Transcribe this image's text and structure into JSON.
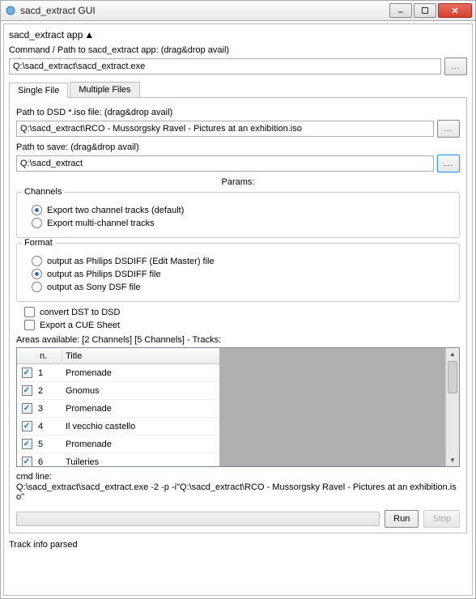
{
  "window": {
    "title": "sacd_extract GUI"
  },
  "header": {
    "appLabel": "sacd_extract app"
  },
  "command": {
    "label": "Command / Path to sacd_extract app: (drag&drop avail)",
    "value": "Q:\\sacd_extract\\sacd_extract.exe",
    "browse": "..."
  },
  "tabs": {
    "single": "Single File",
    "multiple": "Multiple Files"
  },
  "single": {
    "isoLabel": "Path to DSD *.iso file: (drag&drop avail)",
    "isoValue": "Q:\\sacd_extract\\RCO - Mussorgsky Ravel - Pictures at an exhibition.iso",
    "saveLabel": "Path to save: (drag&drop avail)",
    "saveValue": "Q:\\sacd_extract",
    "browse": "..."
  },
  "params": {
    "title": "Params:",
    "channelsLabel": "Channels",
    "channels": {
      "two": "Export two channel tracks (default)",
      "multi": "Export multi-channel tracks"
    },
    "formatLabel": "Format",
    "format": {
      "dsdiff_edit": "output as Philips DSDIFF (Edit Master) file",
      "dsdiff": "output as Philips DSDIFF file",
      "dsf": "output as Sony DSF file"
    },
    "convertDST": "convert DST to DSD",
    "exportCUE": "Export a CUE Sheet"
  },
  "areas": {
    "label": "Areas available: [2 Channels] [5 Channels] - Tracks:",
    "cols": {
      "n": "n.",
      "title": "Title"
    },
    "tracks": [
      {
        "n": "1",
        "title": "Promenade"
      },
      {
        "n": "2",
        "title": "Gnomus"
      },
      {
        "n": "3",
        "title": "Promenade"
      },
      {
        "n": "4",
        "title": "Il vecchio castello"
      },
      {
        "n": "5",
        "title": "Promenade"
      },
      {
        "n": "6",
        "title": "Tuileries"
      }
    ]
  },
  "cmdline": {
    "label": "cmd line:",
    "value": "Q:\\sacd_extract\\sacd_extract.exe -2 -p  -i\"Q:\\sacd_extract\\RCO - Mussorgsky Ravel - Pictures at an exhibition.iso\""
  },
  "buttons": {
    "run": "Run",
    "stop": "Stop"
  },
  "status": "Track info parsed"
}
